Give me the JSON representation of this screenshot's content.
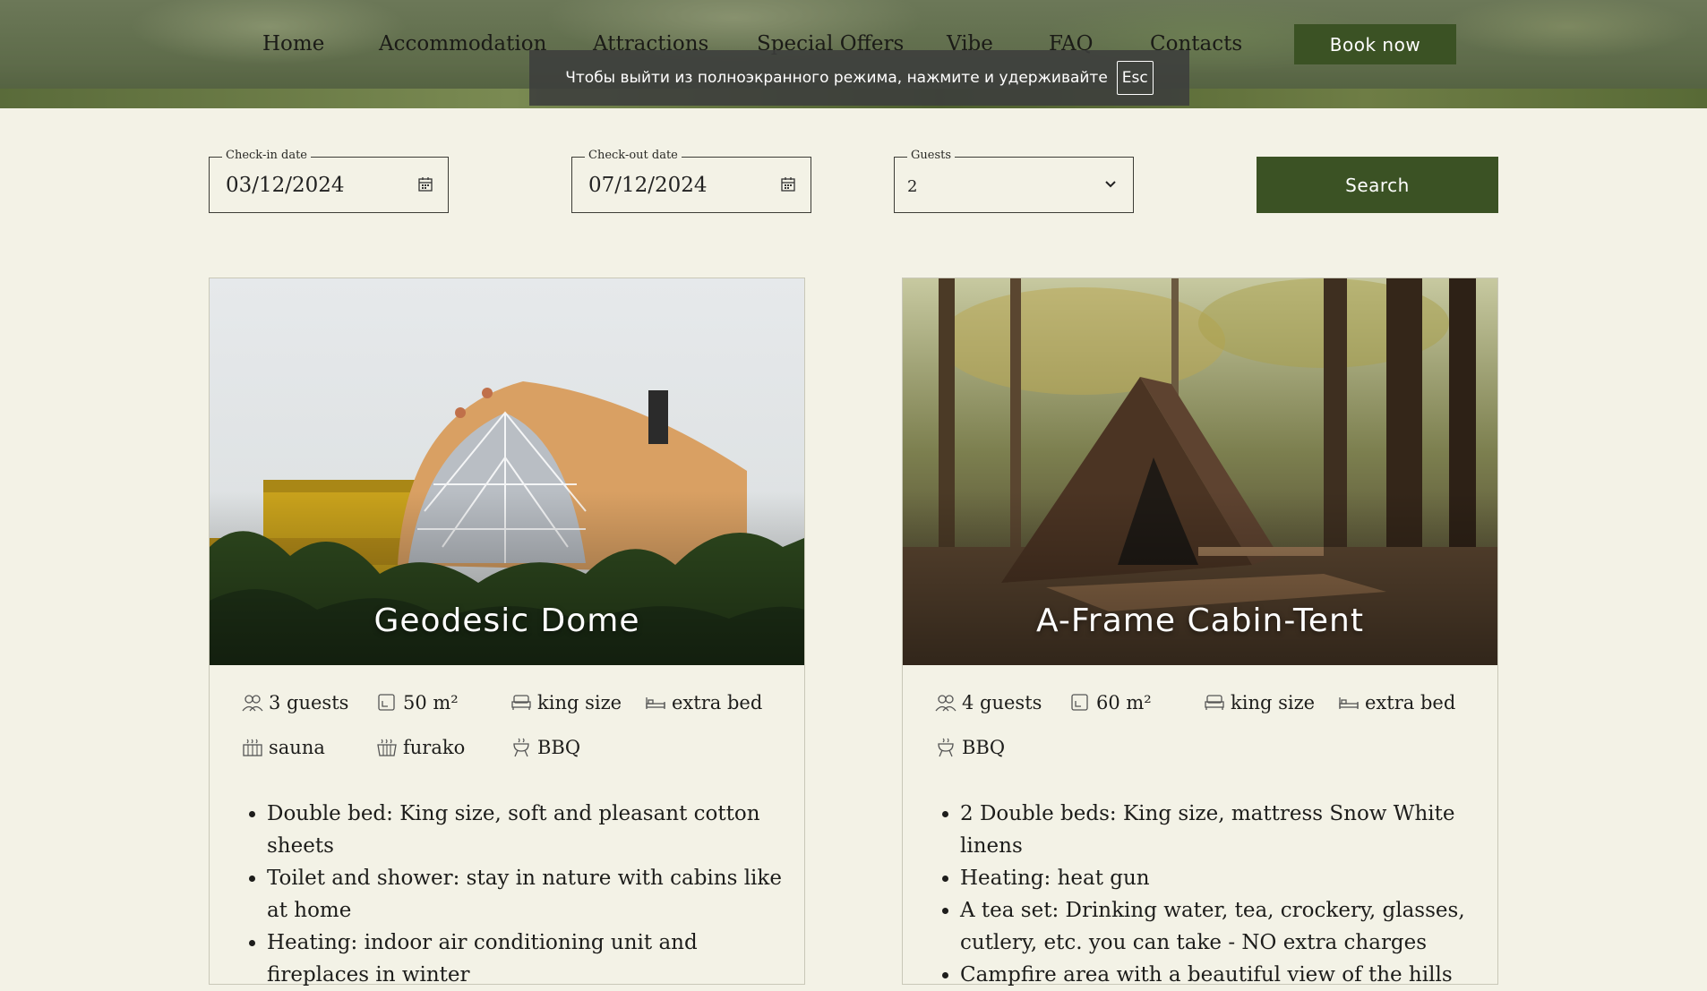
{
  "nav": {
    "items": [
      {
        "label": "Home"
      },
      {
        "label": "Accommodation"
      },
      {
        "label": "Attractions"
      },
      {
        "label": "Special Offers"
      },
      {
        "label": "Vibe"
      },
      {
        "label": "FAQ"
      },
      {
        "label": "Contacts"
      }
    ],
    "book_label": "Book now"
  },
  "fullscreen_toast": {
    "text": "Чтобы выйти из полноэкранного режима, нажмите и удерживайте",
    "key": "Esc"
  },
  "search": {
    "checkin": {
      "label": "Check-in date",
      "value": "03/12/2024"
    },
    "checkout": {
      "label": "Check-out date",
      "value": "07/12/2024"
    },
    "guests": {
      "label": "Guests",
      "value": "2"
    },
    "button_label": "Search"
  },
  "cards": [
    {
      "title": "Geodesic Dome",
      "amenities": [
        {
          "icon": "guests-icon",
          "label": "3 guests"
        },
        {
          "icon": "area-icon",
          "label": "50 m²"
        },
        {
          "icon": "bed-icon",
          "label": "king size"
        },
        {
          "icon": "extra-bed-icon",
          "label": "extra bed"
        },
        {
          "icon": "sauna-icon",
          "label": "sauna"
        },
        {
          "icon": "furako-icon",
          "label": "furako"
        },
        {
          "icon": "bbq-icon",
          "label": "BBQ"
        }
      ],
      "features": [
        "Double bed: King size, soft and pleasant cotton sheets",
        "Toilet and shower: stay in nature with cabins like at home",
        "Heating: indoor air conditioning unit and fireplaces in winter"
      ]
    },
    {
      "title": "A-Frame Cabin-Tent",
      "amenities": [
        {
          "icon": "guests-icon",
          "label": "4 guests"
        },
        {
          "icon": "area-icon",
          "label": "60 m²"
        },
        {
          "icon": "bed-icon",
          "label": "king size"
        },
        {
          "icon": "extra-bed-icon",
          "label": "extra bed"
        },
        {
          "icon": "bbq-icon",
          "label": "BBQ"
        }
      ],
      "features": [
        "2 Double beds: King size, mattress Snow White linens",
        "Heating: heat gun",
        "A tea set: Drinking water, tea, crockery, glasses, cutlery, etc. you can take - NO extra charges",
        "Campfire area with a beautiful view of the hills"
      ]
    }
  ],
  "colors": {
    "accent": "#3b5224",
    "background": "#f3f2e6"
  }
}
